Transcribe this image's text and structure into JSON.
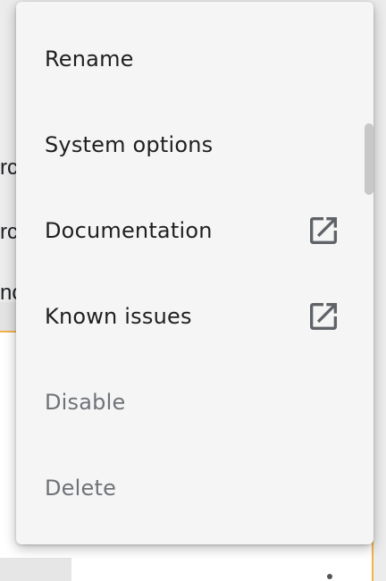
{
  "background": {
    "partial_text_1": "rc",
    "partial_text_2": "rc",
    "partial_text_3": "nc"
  },
  "menu": {
    "items": [
      {
        "label": "Rename",
        "disabled": false,
        "external": false
      },
      {
        "label": "System options",
        "disabled": false,
        "external": false
      },
      {
        "label": "Documentation",
        "disabled": false,
        "external": true,
        "icon": "open-in-new-icon"
      },
      {
        "label": "Known issues",
        "disabled": false,
        "external": true,
        "icon": "open-in-new-icon"
      },
      {
        "label": "Disable",
        "disabled": true,
        "external": false
      },
      {
        "label": "Delete",
        "disabled": true,
        "external": false
      }
    ]
  },
  "colors": {
    "menu_background": "#f5f5f5",
    "text_primary": "#1f1f1f",
    "text_disabled": "#6f7378",
    "icon": "#5f6368",
    "card_accent": "#f3b24a"
  }
}
